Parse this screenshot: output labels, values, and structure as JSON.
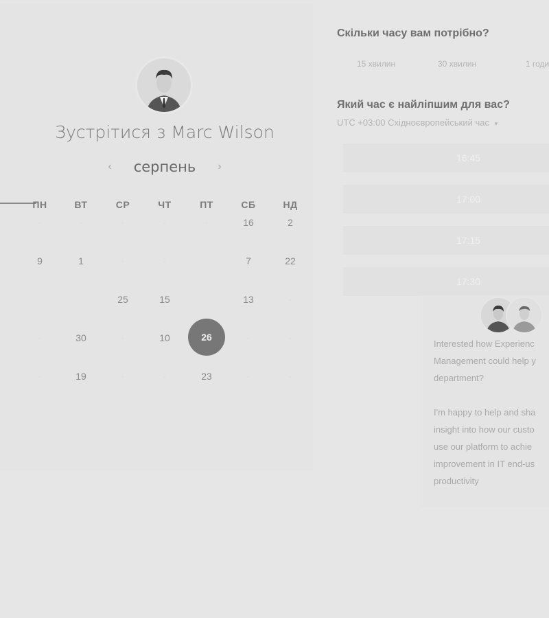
{
  "host": {
    "title": "Зустрітися з Marc Wilson",
    "avatar": "host-avatar"
  },
  "calendar": {
    "month": "серпень",
    "prev_icon": "chevron-left-icon",
    "next_icon": "chevron-right-icon",
    "weekdays": [
      "ПН",
      "ВТ",
      "СР",
      "ЧТ",
      "ПТ",
      "СБ",
      "НД"
    ],
    "weeks": [
      [
        "",
        "",
        "",
        "",
        "",
        "16",
        "2"
      ],
      [
        "9",
        "1",
        "",
        "",
        "",
        "7",
        "22"
      ],
      [
        "",
        "",
        "25",
        "15",
        "",
        "13",
        ""
      ],
      [
        "",
        "30",
        "",
        "10",
        "26",
        "",
        ""
      ],
      [
        "",
        "19",
        "",
        "",
        "23",
        "",
        ""
      ]
    ],
    "selected": "26"
  },
  "duration": {
    "question": "Скільки часу вам потрібно?",
    "options": [
      "15 хвилин",
      "30 хвилин",
      "1 годи"
    ]
  },
  "time": {
    "question": "Який час є найліпшим для вас?",
    "timezone": "UTC +03:00 Східноєвропейський час",
    "timezone_icon": "caret-down-icon",
    "slots": [
      "16:45",
      "17:00",
      "17:15",
      "17:30"
    ]
  },
  "info": {
    "avatars": [
      "person-avatar-1",
      "person-avatar-2"
    ],
    "lines": [
      "Interested how Experienc",
      "Management could help y",
      "department?",
      "",
      "I'm happy to help and sha",
      "insight into how our custo",
      "use our platform to achie",
      "improvement in IT end-us",
      "productivity"
    ]
  }
}
